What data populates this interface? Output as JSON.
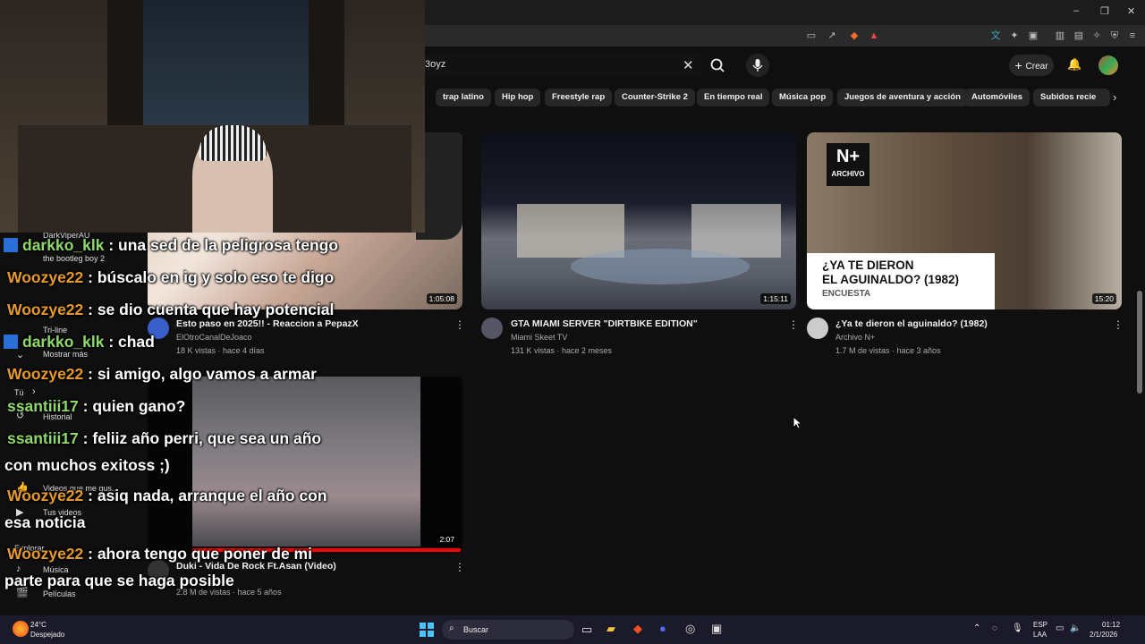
{
  "browser": {
    "window_controls": [
      "–",
      "❐",
      "✕"
    ]
  },
  "youtube": {
    "search_value": "3oyz",
    "create_label": "Crear",
    "chips": [
      "trap latino",
      "Hip hop",
      "Freestyle rap",
      "Counter-Strike 2",
      "En tiempo real",
      "Música pop",
      "Juegos de aventura y acción",
      "Automóviles",
      "Subidos recie"
    ],
    "videos": [
      {
        "title": "Esto paso en 2025!! - Reaccion a PepazX",
        "channel": "ElOtroCanalDeJoaco",
        "meta": "18 K vistas · hace 4 días",
        "duration": "1:05:08"
      },
      {
        "title": "GTA MIAMI SERVER \"DIRTBIKE EDITION\"",
        "channel": "Miami Skeet TV",
        "meta": "131 K vistas · hace 2 meses",
        "duration": "1:15:11"
      },
      {
        "title": "¿Ya te dieron el aguinaldo? (1982)",
        "channel": "Archivo N+",
        "meta": "1.7 M de vistas · hace 3 años",
        "duration": "15:20",
        "thumb_badge": "ARCHIVO",
        "thumb_caption": "¿YA TE DIERON\nEL AGUINALDO? (1982)",
        "thumb_tag": "ENCUESTA"
      },
      {
        "title": "Duki - Vida De Rock Ft.Asan (Video)",
        "channel": "",
        "meta": "2.8 M de vistas · hace 5 años",
        "duration": "2:07"
      }
    ],
    "sidebar": {
      "items": [
        "DarkViperAU",
        "the bootleg boy 2",
        "Tri-line",
        "Mostrar más",
        "Tú",
        "Historial",
        "Videos que me gus...",
        "Tus videos",
        "Explorar",
        "Música",
        "Películas"
      ]
    }
  },
  "chat": [
    {
      "user": "darkko_klk",
      "text": " : una sed de la peligrosa tengo",
      "badge": true
    },
    {
      "user": "Woozye22",
      "text": " : búscalo en ig y solo eso te digo"
    },
    {
      "user": "Woozye22",
      "text": " : se dio cuenta que hay potencial"
    },
    {
      "user": "darkko_klk",
      "text": " : chad",
      "badge": true
    },
    {
      "user": "Woozye22",
      "text": " : si amigo, algo vamos a armar"
    },
    {
      "user": "ssantiii17",
      "text": " : quien gano?"
    },
    {
      "user": "ssantiii17",
      "text": " : feliiz año perri, que sea un año"
    },
    {
      "user": "",
      "text": "con muchos exitoss ;)"
    },
    {
      "user": "Woozye22",
      "text": " : asiq nada, arranque el año con"
    },
    {
      "user": "",
      "text": "esa noticia"
    },
    {
      "user": "Woozye22",
      "text": " : ahora tengo que poner de mi"
    },
    {
      "user": "",
      "text": "parte para que se haga posible"
    }
  ],
  "taskbar": {
    "weather_temp": "24°C",
    "weather_desc": "Despejado",
    "search_label": "Buscar",
    "lang": "ESP",
    "lang2": "LAA",
    "time": "01:12",
    "date": "2/1/2026"
  }
}
